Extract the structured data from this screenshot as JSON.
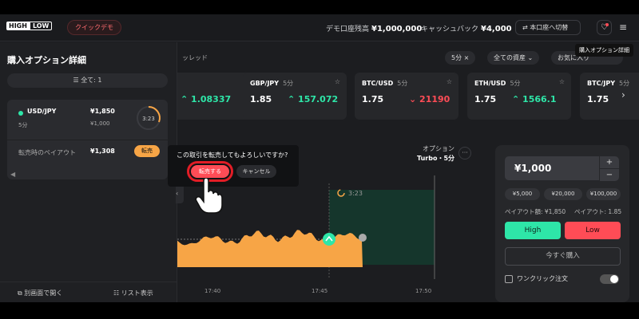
{
  "header": {
    "logo_high": "HIGH",
    "logo_low": "LOW",
    "demo_label": "クイックデモ",
    "balance_label": "デモ口座残高",
    "balance_value": "¥1,000,000",
    "cashback_label": "キャッシュバック",
    "cashback_value": "¥4,000",
    "switch_label": "本口座へ切替",
    "tooltip": "購入オプション詳細"
  },
  "panel": {
    "title": "購入オプション詳細",
    "filter_label": "全て: 1",
    "position": {
      "symbol": "USD/JPY",
      "expiry": "5分",
      "payout_amount": "¥1,850",
      "stake": "¥1,000",
      "timer": "3:23",
      "resell_label": "転売時のペイアウト",
      "resell_value": "¥1,308",
      "sell_button": "転売"
    },
    "footer_open": "別画面で開く",
    "footer_list": "リスト表示"
  },
  "strip": {
    "label": "ッレッド",
    "chip_5min": "5分",
    "chip_assets": "全ての資産",
    "chip_favorites": "お気に入り",
    "assets": [
      {
        "name": "",
        "period": "",
        "payout": "",
        "rate": "1.08337",
        "dir": "up"
      },
      {
        "name": "GBP/JPY",
        "period": "5分",
        "payout": "1.85",
        "rate": "157.072",
        "dir": "up"
      },
      {
        "name": "BTC/USD",
        "period": "5分",
        "payout": "1.75",
        "rate": "21190",
        "dir": "down"
      },
      {
        "name": "ETH/USD",
        "period": "5分",
        "payout": "1.75",
        "rate": "1566.1",
        "dir": "up"
      },
      {
        "name": "BTC/JPY",
        "period": "5分",
        "payout": "1.75",
        "rate": "",
        "dir": "up"
      }
    ]
  },
  "chart": {
    "option_label": "オプション",
    "option_type": "Turbo・5分",
    "timer": "3:23",
    "x_ticks": [
      "17:40",
      "17:45",
      "17:50"
    ],
    "series_color": "#f7a546"
  },
  "trade": {
    "amount": "¥1,000",
    "plus": "+",
    "minus": "−",
    "presets": [
      "¥5,000",
      "¥20,000",
      "¥100,000"
    ],
    "payout_amount": "ペイアウト額: ¥1,850",
    "payout_rate": "ペイアウト: 1.85",
    "high_label": "High",
    "low_label": "Low",
    "buy_label": "今すぐ購入",
    "oneclick_label": "ワンクリック注文",
    "oneclick_enabled": false
  },
  "dialog": {
    "question": "この取引を転売してもよろしいですか?",
    "confirm": "転売する",
    "cancel": "キャンセル"
  },
  "colors": {
    "up": "#2ee6a8",
    "down": "#ff4c56",
    "accent": "#f7a546"
  }
}
